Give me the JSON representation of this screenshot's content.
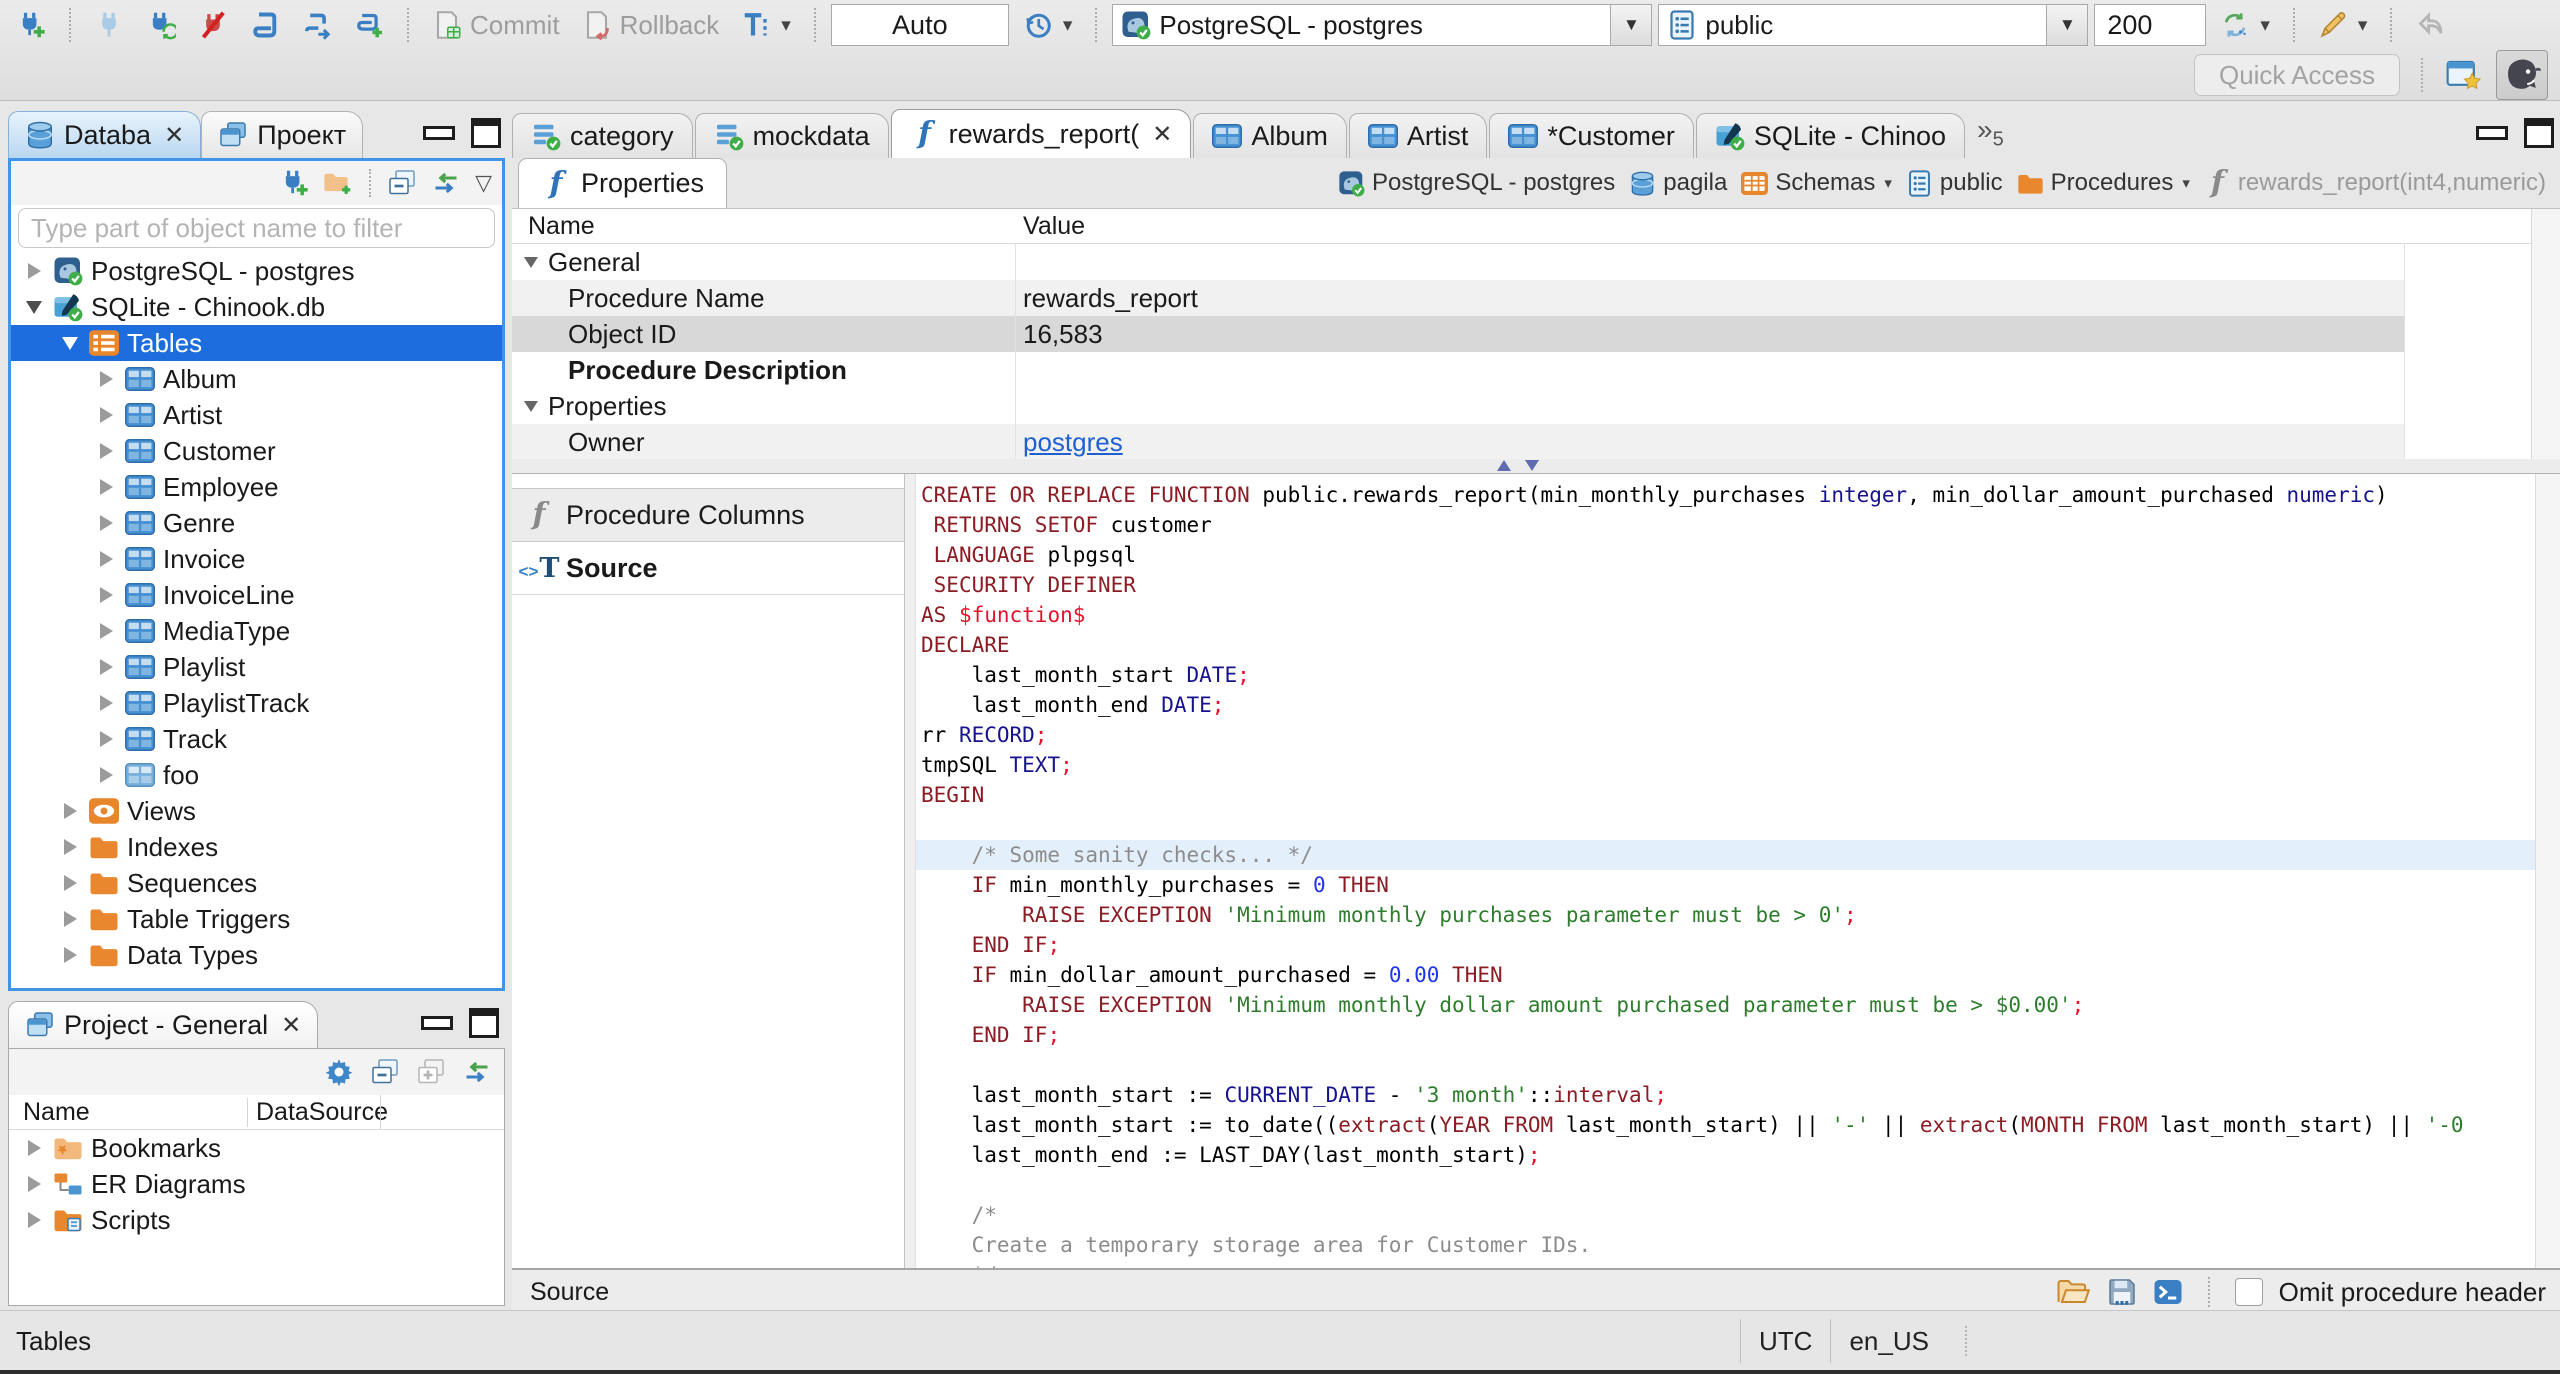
{
  "colors": {
    "selection": "#1d6ddf",
    "link": "#1f5fd0",
    "kw": "#8b1c24",
    "ty": "#16138c",
    "st": "#2d7d2d",
    "nm": "#2135ee",
    "cm": "#8c8c8c",
    "sc": "#e8112d",
    "line_highlight": "#e4effc"
  },
  "toolbar": {
    "commit": "Commit",
    "rollback": "Rollback",
    "auto": "Auto",
    "connection": "PostgreSQL - postgres",
    "schema": "public",
    "fetch_size": "200",
    "quick_access": "Quick Access"
  },
  "left": {
    "tabs": [
      {
        "label": "Databa"
      },
      {
        "label": "Проект"
      }
    ],
    "filter_placeholder": "Type part of object name to filter",
    "tree": [
      {
        "label": "PostgreSQL - postgres",
        "icon": "postgres",
        "depth": 0,
        "state": "collapsed"
      },
      {
        "label": "SQLite - Chinook.db",
        "icon": "sqlite",
        "depth": 0,
        "state": "expanded"
      },
      {
        "label": "Tables",
        "icon": "tablesfolder",
        "depth": 1,
        "state": "expanded",
        "selected": true
      },
      {
        "label": "Album",
        "icon": "table",
        "depth": 2,
        "state": "collapsed"
      },
      {
        "label": "Artist",
        "icon": "table",
        "depth": 2,
        "state": "collapsed"
      },
      {
        "label": "Customer",
        "icon": "table",
        "depth": 2,
        "state": "collapsed"
      },
      {
        "label": "Employee",
        "icon": "table",
        "depth": 2,
        "state": "collapsed"
      },
      {
        "label": "Genre",
        "icon": "table",
        "depth": 2,
        "state": "collapsed"
      },
      {
        "label": "Invoice",
        "icon": "table",
        "depth": 2,
        "state": "collapsed"
      },
      {
        "label": "InvoiceLine",
        "icon": "table",
        "depth": 2,
        "state": "collapsed"
      },
      {
        "label": "MediaType",
        "icon": "table",
        "depth": 2,
        "state": "collapsed"
      },
      {
        "label": "Playlist",
        "icon": "table",
        "depth": 2,
        "state": "collapsed"
      },
      {
        "label": "PlaylistTrack",
        "icon": "table",
        "depth": 2,
        "state": "collapsed"
      },
      {
        "label": "Track",
        "icon": "table",
        "depth": 2,
        "state": "collapsed"
      },
      {
        "label": "foo",
        "icon": "tablelight",
        "depth": 2,
        "state": "collapsed"
      },
      {
        "label": "Views",
        "icon": "views",
        "depth": 1,
        "state": "collapsed"
      },
      {
        "label": "Indexes",
        "icon": "folder",
        "depth": 1,
        "state": "collapsed"
      },
      {
        "label": "Sequences",
        "icon": "folder",
        "depth": 1,
        "state": "collapsed"
      },
      {
        "label": "Table Triggers",
        "icon": "folder",
        "depth": 1,
        "state": "collapsed"
      },
      {
        "label": "Data Types",
        "icon": "folder",
        "depth": 1,
        "state": "collapsed"
      }
    ]
  },
  "project_panel": {
    "tab_label": "Project - General",
    "columns": [
      "Name",
      "DataSource"
    ],
    "rows": [
      {
        "label": "Bookmarks",
        "icon": "bookmarks"
      },
      {
        "label": "ER Diagrams",
        "icon": "erd"
      },
      {
        "label": "Scripts",
        "icon": "scripts"
      }
    ]
  },
  "editor": {
    "tabs": [
      {
        "label": "category",
        "icon": "sqlfile"
      },
      {
        "label": "mockdata",
        "icon": "sqlfile"
      },
      {
        "label": "rewards_report(",
        "icon": "funcblue",
        "active": true,
        "closable": true
      },
      {
        "label": "Album",
        "icon": "table"
      },
      {
        "label": "Artist",
        "icon": "table"
      },
      {
        "label": "*Customer",
        "icon": "table"
      },
      {
        "label": "SQLite - Chinoo",
        "icon": "sqlite"
      }
    ],
    "overflow_count": "5",
    "properties_tab_label": "Properties",
    "breadcrumb": [
      {
        "label": "PostgreSQL - postgres",
        "icon": "postgres"
      },
      {
        "label": "pagila",
        "icon": "dbcyl"
      },
      {
        "label": "Schemas",
        "icon": "schemas",
        "dropdown": true
      },
      {
        "label": "public",
        "icon": "schemapage"
      },
      {
        "label": "Procedures",
        "icon": "folder",
        "dropdown": true
      },
      {
        "label": "rewards_report(int4,numeric)",
        "icon": "funcgray",
        "muted": true
      }
    ],
    "grid": {
      "columns": [
        "Name",
        "Value"
      ],
      "rows": [
        {
          "name": "General",
          "group": true
        },
        {
          "name": "Procedure Name",
          "value": "rewards_report",
          "shaded": true
        },
        {
          "name": "Object ID",
          "value": "16,583",
          "selected": true
        },
        {
          "name": "Procedure Description",
          "bold": true
        },
        {
          "name": "Properties",
          "group": true
        },
        {
          "name": "Owner",
          "value": "postgres",
          "link": true,
          "shaded": true
        }
      ]
    },
    "subtabs": [
      {
        "label": "Procedure Columns",
        "icon": "funcgray"
      },
      {
        "label": "Source",
        "icon": "sourceicon",
        "active": true
      }
    ],
    "code": [
      {
        "segs": [
          [
            "kw",
            "CREATE OR REPLACE FUNCTION"
          ],
          [
            "pl",
            " public.rewards_report(min_monthly_purchases "
          ],
          [
            "ty",
            "integer"
          ],
          [
            "pl",
            ", min_dollar_amount_purchased "
          ],
          [
            "ty",
            "numeric"
          ],
          [
            "pl",
            ")"
          ]
        ]
      },
      {
        "segs": [
          [
            "pl",
            " "
          ],
          [
            "kw",
            "RETURNS SETOF"
          ],
          [
            "pl",
            " customer"
          ]
        ]
      },
      {
        "segs": [
          [
            "pl",
            " "
          ],
          [
            "kw",
            "LANGUAGE"
          ],
          [
            "pl",
            " plpgsql"
          ]
        ]
      },
      {
        "segs": [
          [
            "pl",
            " "
          ],
          [
            "kw",
            "SECURITY DEFINER"
          ]
        ]
      },
      {
        "segs": [
          [
            "kw",
            "AS"
          ],
          [
            "pl",
            " "
          ],
          [
            "sc",
            "$function$"
          ]
        ]
      },
      {
        "segs": [
          [
            "kw",
            "DECLARE"
          ]
        ]
      },
      {
        "segs": [
          [
            "pl",
            "    last_month_start "
          ],
          [
            "ty",
            "DATE"
          ],
          [
            "sc",
            ";"
          ]
        ]
      },
      {
        "segs": [
          [
            "pl",
            "    last_month_end "
          ],
          [
            "ty",
            "DATE"
          ],
          [
            "sc",
            ";"
          ]
        ]
      },
      {
        "segs": [
          [
            "pl",
            "rr "
          ],
          [
            "ty",
            "RECORD"
          ],
          [
            "sc",
            ";"
          ]
        ]
      },
      {
        "segs": [
          [
            "pl",
            "tmpSQL "
          ],
          [
            "ty",
            "TEXT"
          ],
          [
            "sc",
            ";"
          ]
        ]
      },
      {
        "segs": [
          [
            "kw",
            "BEGIN"
          ]
        ]
      },
      {
        "segs": []
      },
      {
        "hl": true,
        "segs": [
          [
            "cm",
            "    /* Some sanity checks... */"
          ]
        ]
      },
      {
        "segs": [
          [
            "pl",
            "    "
          ],
          [
            "kw",
            "IF"
          ],
          [
            "pl",
            " min_monthly_purchases = "
          ],
          [
            "nm",
            "0"
          ],
          [
            "pl",
            " "
          ],
          [
            "kw",
            "THEN"
          ]
        ]
      },
      {
        "segs": [
          [
            "pl",
            "        "
          ],
          [
            "kw",
            "RAISE EXCEPTION"
          ],
          [
            "pl",
            " "
          ],
          [
            "st",
            "'Minimum monthly purchases parameter must be > 0'"
          ],
          [
            "sc",
            ";"
          ]
        ]
      },
      {
        "segs": [
          [
            "pl",
            "    "
          ],
          [
            "kw",
            "END IF"
          ],
          [
            "sc",
            ";"
          ]
        ]
      },
      {
        "segs": [
          [
            "pl",
            "    "
          ],
          [
            "kw",
            "IF"
          ],
          [
            "pl",
            " min_dollar_amount_purchased = "
          ],
          [
            "nm",
            "0.00"
          ],
          [
            "pl",
            " "
          ],
          [
            "kw",
            "THEN"
          ]
        ]
      },
      {
        "segs": [
          [
            "pl",
            "        "
          ],
          [
            "kw",
            "RAISE EXCEPTION"
          ],
          [
            "pl",
            " "
          ],
          [
            "st",
            "'Minimum monthly dollar amount purchased parameter must be > $0.00'"
          ],
          [
            "sc",
            ";"
          ]
        ]
      },
      {
        "segs": [
          [
            "pl",
            "    "
          ],
          [
            "kw",
            "END IF"
          ],
          [
            "sc",
            ";"
          ]
        ]
      },
      {
        "segs": []
      },
      {
        "segs": [
          [
            "pl",
            "    last_month_start := "
          ],
          [
            "ty",
            "CURRENT_DATE"
          ],
          [
            "pl",
            " - "
          ],
          [
            "st",
            "'3 month'"
          ],
          [
            "pl",
            "::"
          ],
          [
            "kw",
            "interval"
          ],
          [
            "sc",
            ";"
          ]
        ]
      },
      {
        "segs": [
          [
            "pl",
            "    last_month_start := to_date(("
          ],
          [
            "kw",
            "extract"
          ],
          [
            "pl",
            "("
          ],
          [
            "kw",
            "YEAR FROM"
          ],
          [
            "pl",
            " last_month_start) || "
          ],
          [
            "st",
            "'-'"
          ],
          [
            "pl",
            " || "
          ],
          [
            "kw",
            "extract"
          ],
          [
            "pl",
            "("
          ],
          [
            "kw",
            "MONTH FROM"
          ],
          [
            "pl",
            " last_month_start) || "
          ],
          [
            "st",
            "'-0"
          ]
        ]
      },
      {
        "segs": [
          [
            "pl",
            "    last_month_end := LAST_DAY(last_month_start)"
          ],
          [
            "sc",
            ";"
          ]
        ]
      },
      {
        "segs": []
      },
      {
        "segs": [
          [
            "cm",
            "    /*"
          ]
        ]
      },
      {
        "segs": [
          [
            "cm",
            "    Create a temporary storage area for Customer IDs."
          ]
        ]
      },
      {
        "segs": [
          [
            "cm",
            "    */"
          ]
        ]
      }
    ],
    "footer": {
      "label": "Source",
      "omit_label": "Omit procedure header",
      "checkbox_checked": false
    }
  },
  "statusbar": {
    "left": "Tables",
    "timezone": "UTC",
    "locale": "en_US"
  }
}
